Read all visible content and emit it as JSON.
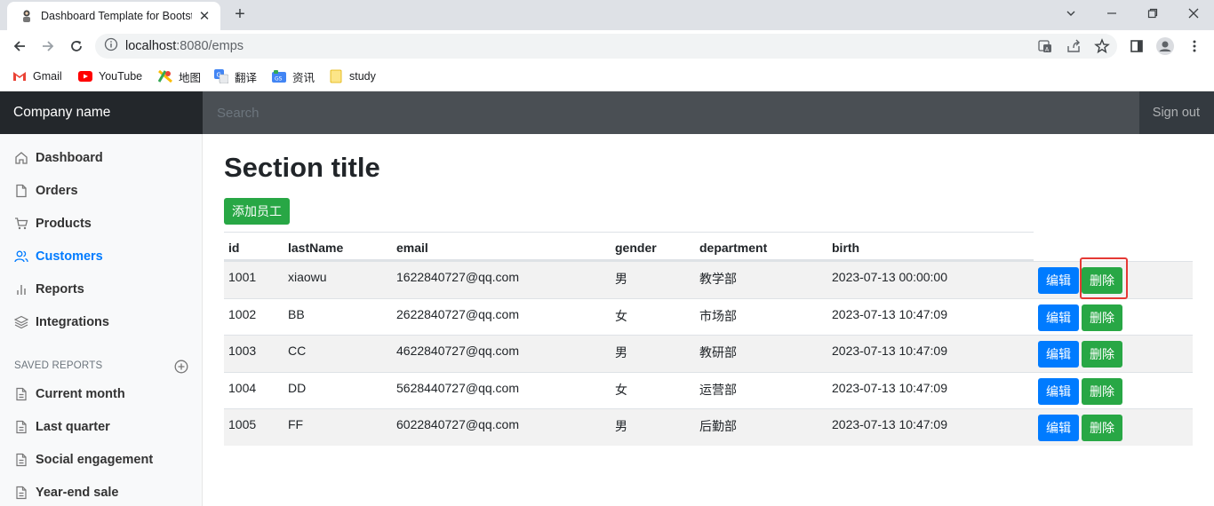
{
  "browser": {
    "tab_title": "Dashboard Template for Bootstrap",
    "tab_close": "✕",
    "new_tab": "+",
    "url_host": "localhost",
    "url_rest": ":8080/emps"
  },
  "bookmarks": [
    {
      "label": "Gmail",
      "icon": "gmail-icon"
    },
    {
      "label": "YouTube",
      "icon": "youtube-icon"
    },
    {
      "label": "地图",
      "icon": "maps-icon"
    },
    {
      "label": "翻译",
      "icon": "translate-icon"
    },
    {
      "label": "资讯",
      "icon": "news-icon"
    },
    {
      "label": "study",
      "icon": "folder-icon"
    }
  ],
  "navbar": {
    "brand": "Company name",
    "search_placeholder": "Search",
    "signout": "Sign out"
  },
  "sidebar": {
    "items": [
      {
        "label": "Dashboard",
        "icon": "home-icon",
        "active": false
      },
      {
        "label": "Orders",
        "icon": "file-icon",
        "active": false
      },
      {
        "label": "Products",
        "icon": "cart-icon",
        "active": false
      },
      {
        "label": "Customers",
        "icon": "users-icon",
        "active": true
      },
      {
        "label": "Reports",
        "icon": "bar-chart-icon",
        "active": false
      },
      {
        "label": "Integrations",
        "icon": "layers-icon",
        "active": false
      }
    ],
    "saved_heading": "SAVED REPORTS",
    "saved": [
      {
        "label": "Current month"
      },
      {
        "label": "Last quarter"
      },
      {
        "label": "Social engagement"
      },
      {
        "label": "Year-end sale"
      }
    ]
  },
  "main": {
    "title": "Section title",
    "add_button": "添加员工",
    "columns": [
      "id",
      "lastName",
      "email",
      "gender",
      "department",
      "birth"
    ],
    "rows": [
      {
        "id": "1001",
        "lastName": "xiaowu",
        "email": "1622840727@qq.com",
        "gender": "男",
        "department": "教学部",
        "birth": "2023-07-13 00:00:00"
      },
      {
        "id": "1002",
        "lastName": "BB",
        "email": "2622840727@qq.com",
        "gender": "女",
        "department": "市场部",
        "birth": "2023-07-13 10:47:09"
      },
      {
        "id": "1003",
        "lastName": "CC",
        "email": "4622840727@qq.com",
        "gender": "男",
        "department": "教研部",
        "birth": "2023-07-13 10:47:09"
      },
      {
        "id": "1004",
        "lastName": "DD",
        "email": "5628440727@qq.com",
        "gender": "女",
        "department": "运营部",
        "birth": "2023-07-13 10:47:09"
      },
      {
        "id": "1005",
        "lastName": "FF",
        "email": "6022840727@qq.com",
        "gender": "男",
        "department": "后勤部",
        "birth": "2023-07-13 10:47:09"
      }
    ],
    "edit_label": "编辑",
    "delete_label": "删除"
  },
  "colors": {
    "primary": "#007bff",
    "success": "#28a745",
    "navbar": "#343a40",
    "highlight": "#e53935"
  }
}
